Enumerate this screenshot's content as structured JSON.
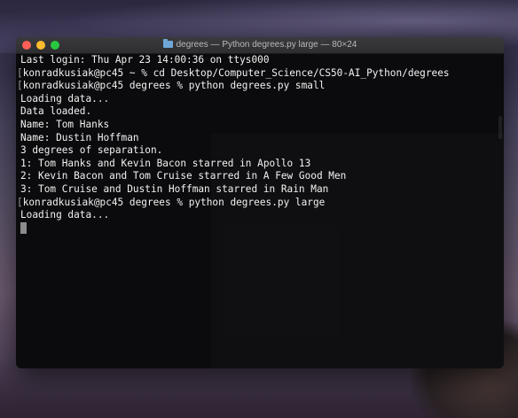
{
  "window": {
    "title": "degrees — Python degrees.py large — 80×24"
  },
  "terminal": {
    "lines": [
      {
        "prompt": false,
        "text": "Last login: Thu Apr 23 14:00:36 on ttys000"
      },
      {
        "prompt": true,
        "text": "konradkusiak@pc45 ~ % cd Desktop/Computer_Science/CS50-AI_Python/degrees"
      },
      {
        "prompt": true,
        "text": "konradkusiak@pc45 degrees % python degrees.py small"
      },
      {
        "prompt": false,
        "text": "Loading data..."
      },
      {
        "prompt": false,
        "text": "Data loaded."
      },
      {
        "prompt": false,
        "text": "Name: Tom Hanks"
      },
      {
        "prompt": false,
        "text": "Name: Dustin Hoffman"
      },
      {
        "prompt": false,
        "text": "3 degrees of separation."
      },
      {
        "prompt": false,
        "text": "1: Tom Hanks and Kevin Bacon starred in Apollo 13"
      },
      {
        "prompt": false,
        "text": "2: Kevin Bacon and Tom Cruise starred in A Few Good Men"
      },
      {
        "prompt": false,
        "text": "3: Tom Cruise and Dustin Hoffman starred in Rain Man"
      },
      {
        "prompt": true,
        "text": "konradkusiak@pc45 degrees % python degrees.py large"
      },
      {
        "prompt": false,
        "text": "Loading data..."
      }
    ]
  },
  "colors": {
    "close": "#fe5f57",
    "minimize": "#febc2e",
    "maximize": "#28c840",
    "text": "#f2f2f2",
    "background": "#0b0b0d"
  }
}
